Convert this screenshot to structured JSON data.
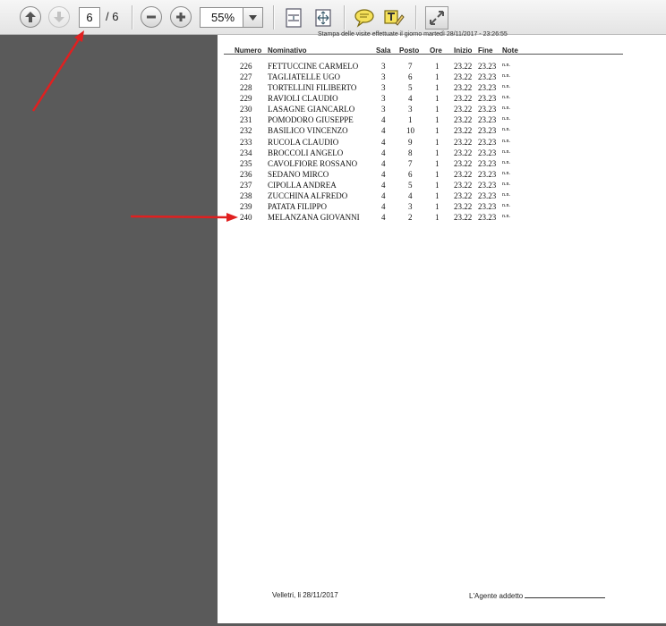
{
  "toolbar": {
    "current_page": "6",
    "page_total": "/ 6",
    "zoom": "55%",
    "icons": [
      "arrow-up-icon",
      "arrow-down-icon",
      "zoom-out-icon",
      "zoom-in-icon",
      "fit-page-icon",
      "fit-width-icon",
      "comment-icon",
      "highlight-text-icon",
      "fullscreen-icon"
    ]
  },
  "document": {
    "header_text": "Stampa delle visite effettuate il giorno martedì 28/11/2017 - 23:26:55",
    "columns": [
      "Numero",
      "Nominativo",
      "Sala",
      "Posto",
      "Ore",
      "Inizio",
      "Fine",
      "Note"
    ],
    "rows": [
      {
        "numero": "226",
        "nome": "FETTUCCINE CARMELO",
        "sala": "3",
        "posto": "7",
        "ore": "1",
        "inizio": "23.22",
        "fine": "23.23",
        "note": "n.n."
      },
      {
        "numero": "227",
        "nome": "TAGLIATELLE UGO",
        "sala": "3",
        "posto": "6",
        "ore": "1",
        "inizio": "23.22",
        "fine": "23.23",
        "note": "n.n."
      },
      {
        "numero": "228",
        "nome": "TORTELLINI FILIBERTO",
        "sala": "3",
        "posto": "5",
        "ore": "1",
        "inizio": "23.22",
        "fine": "23.23",
        "note": "n.n."
      },
      {
        "numero": "229",
        "nome": "RAVIOLI CLAUDIO",
        "sala": "3",
        "posto": "4",
        "ore": "1",
        "inizio": "23.22",
        "fine": "23.23",
        "note": "n.n."
      },
      {
        "numero": "230",
        "nome": "LASAGNE GIANCARLO",
        "sala": "3",
        "posto": "3",
        "ore": "1",
        "inizio": "23.22",
        "fine": "23.23",
        "note": "n.n."
      },
      {
        "numero": "231",
        "nome": "POMODORO GIUSEPPE",
        "sala": "4",
        "posto": "1",
        "ore": "1",
        "inizio": "23.22",
        "fine": "23.23",
        "note": "n.n."
      },
      {
        "numero": "232",
        "nome": "BASILICO VINCENZO",
        "sala": "4",
        "posto": "10",
        "ore": "1",
        "inizio": "23.22",
        "fine": "23.23",
        "note": "n.n."
      },
      {
        "numero": "233",
        "nome": "RUCOLA CLAUDIO",
        "sala": "4",
        "posto": "9",
        "ore": "1",
        "inizio": "23.22",
        "fine": "23.23",
        "note": "n.n."
      },
      {
        "numero": "234",
        "nome": "BROCCOLI ANGELO",
        "sala": "4",
        "posto": "8",
        "ore": "1",
        "inizio": "23.22",
        "fine": "23.23",
        "note": "n.n."
      },
      {
        "numero": "235",
        "nome": "CAVOLFIORE ROSSANO",
        "sala": "4",
        "posto": "7",
        "ore": "1",
        "inizio": "23.22",
        "fine": "23.23",
        "note": "n.n."
      },
      {
        "numero": "236",
        "nome": "SEDANO MIRCO",
        "sala": "4",
        "posto": "6",
        "ore": "1",
        "inizio": "23.22",
        "fine": "23.23",
        "note": "n.n."
      },
      {
        "numero": "237",
        "nome": "CIPOLLA ANDREA",
        "sala": "4",
        "posto": "5",
        "ore": "1",
        "inizio": "23.22",
        "fine": "23.23",
        "note": "n.n."
      },
      {
        "numero": "238",
        "nome": "ZUCCHINA ALFREDO",
        "sala": "4",
        "posto": "4",
        "ore": "1",
        "inizio": "23.22",
        "fine": "23.23",
        "note": "n.n."
      },
      {
        "numero": "239",
        "nome": "PATATA FILIPPO",
        "sala": "4",
        "posto": "3",
        "ore": "1",
        "inizio": "23.22",
        "fine": "23.23",
        "note": "n.n."
      },
      {
        "numero": "240",
        "nome": "MELANZANA GIOVANNI",
        "sala": "4",
        "posto": "2",
        "ore": "1",
        "inizio": "23.22",
        "fine": "23.23",
        "note": "n.n."
      }
    ],
    "footer_place": "Velletri, li 28/11/2017",
    "footer_sign": "L'Agente addetto"
  },
  "colors": {
    "background": "#5a5a5a",
    "annotation_arrow": "#e02020"
  }
}
